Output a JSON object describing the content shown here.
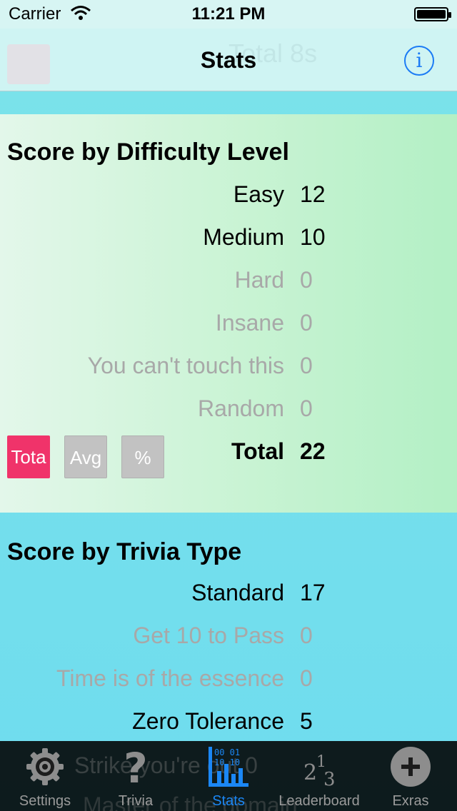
{
  "status_bar": {
    "carrier": "Carrier",
    "time": "11:21 PM"
  },
  "nav": {
    "title": "Stats",
    "info_icon": "info-icon",
    "ghost_text": "Total  8s"
  },
  "difficulty": {
    "header": "Score by Difficulty Level",
    "rows": [
      {
        "label": "Easy",
        "value": "12"
      },
      {
        "label": "Medium",
        "value": "10"
      },
      {
        "label": "Hard",
        "value": "0"
      },
      {
        "label": "Insane",
        "value": "0"
      },
      {
        "label": "You can't touch this",
        "value": "0"
      },
      {
        "label": "Random",
        "value": "0"
      }
    ],
    "total": {
      "label": "Total",
      "value": "22"
    },
    "buttons": {
      "total": "Tota",
      "avg": "Avg",
      "percent": "%"
    }
  },
  "trivia_type": {
    "header": "Score by Trivia Type",
    "rows": [
      {
        "label": "Standard",
        "value": "17"
      },
      {
        "label": "Get 10 to Pass",
        "value": "0"
      },
      {
        "label": "Time is of the essence",
        "value": "0"
      },
      {
        "label": "Zero Tolerance",
        "value": "5"
      }
    ],
    "hidden_row_fragment": "Strike  you're out  0",
    "hidden_row_fragment_2": "Master of the domain"
  },
  "tabs": [
    {
      "label": "Settings",
      "icon": "gear-icon"
    },
    {
      "label": "Trivia",
      "icon": "question-mark-icon"
    },
    {
      "label": "Stats",
      "icon": "binary-chart-icon"
    },
    {
      "label": "Leaderboard",
      "icon": "ranking-icon"
    },
    {
      "label": "Exras",
      "icon": "plus-circle-icon"
    }
  ],
  "colors": {
    "accent": "#1b87f5",
    "total_button": "#f0336a",
    "inactive_button": "#c2c2c2"
  }
}
